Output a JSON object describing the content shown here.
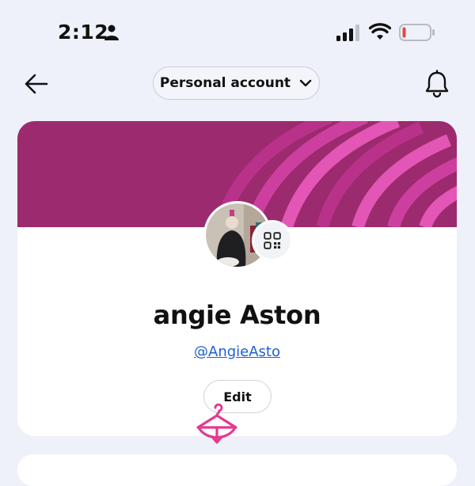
{
  "status_bar": {
    "time": "2:12",
    "icons": [
      "person-icon",
      "cellular-signal-icon",
      "wifi-icon",
      "battery-low-icon"
    ],
    "battery_color": "#e04848"
  },
  "nav": {
    "back_icon": "arrow-left-icon",
    "account_selector_label": "Personal account",
    "account_selector_icon": "chevron-down-icon",
    "notifications_icon": "bell-icon"
  },
  "profile": {
    "banner_color": "#9c2a6e",
    "banner_accent": "#e356b5",
    "qr_icon": "qr-code-icon",
    "display_name": "angie Aston",
    "username": "@AngieAsto",
    "edit_label": "Edit",
    "link_color": "#1d5fd6"
  },
  "overlay": {
    "logo_icon": "hanger-bow-logo-icon",
    "logo_color": "#e23a8f"
  }
}
